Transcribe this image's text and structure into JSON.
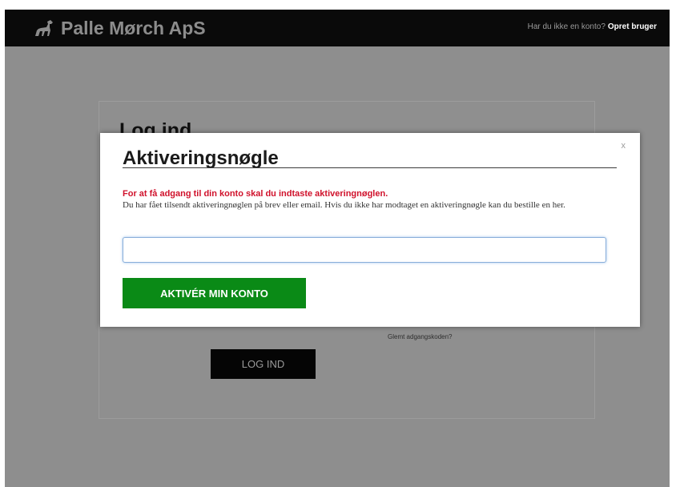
{
  "header": {
    "brand_name": "Palle Mørch ApS",
    "brand_icon": "walking-horse-icon",
    "account_prompt": "Har du ikke en konto?",
    "signup_link": "Opret bruger"
  },
  "login": {
    "title": "Log ind",
    "forgot_password": "Glemt adgangskoden?",
    "submit_label": "LOG IND"
  },
  "modal": {
    "close_label": "x",
    "title": "Aktiveringsnøgle",
    "lead": "For at få adgang til din konto skal du indtaste aktiveringnøglen.",
    "body_text": "Du har fået tilsendt aktiveringnøglen på brev eller email. Hvis du ikke har modtaget en aktiveringnøgle kan du bestille en",
    "here_link": "her",
    "body_end": ".",
    "key_input_value": "",
    "activate_label": "AKTIVÉR MIN KONTO"
  },
  "colors": {
    "topbar": "#0a0a0a",
    "overlay": "#8e8e8e",
    "activate_button": "#0a8a16",
    "lead_text": "#d0112b",
    "input_focus": "#89aeda"
  }
}
